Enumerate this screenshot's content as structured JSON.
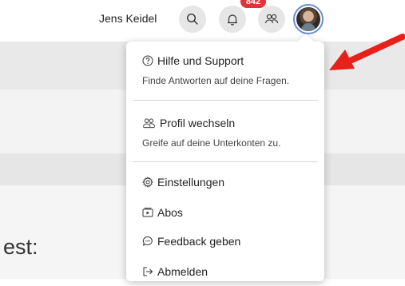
{
  "header": {
    "user_name": "Jens Keidel",
    "notification_count": "842"
  },
  "background": {
    "partial_text": "est:"
  },
  "menu": {
    "help": {
      "title": "Hilfe und Support",
      "subtitle": "Finde Antworten auf deine Fragen."
    },
    "switch_profile": {
      "title": "Profil wechseln",
      "subtitle": "Greife auf deine Unterkonten zu."
    },
    "settings": "Einstellungen",
    "subscriptions": "Abos",
    "feedback": "Feedback geben",
    "logout": "Abmelden"
  },
  "colors": {
    "badge": "#e0333a",
    "arrow": "#e8201a",
    "avatar_ring": "#6a8fd4"
  }
}
